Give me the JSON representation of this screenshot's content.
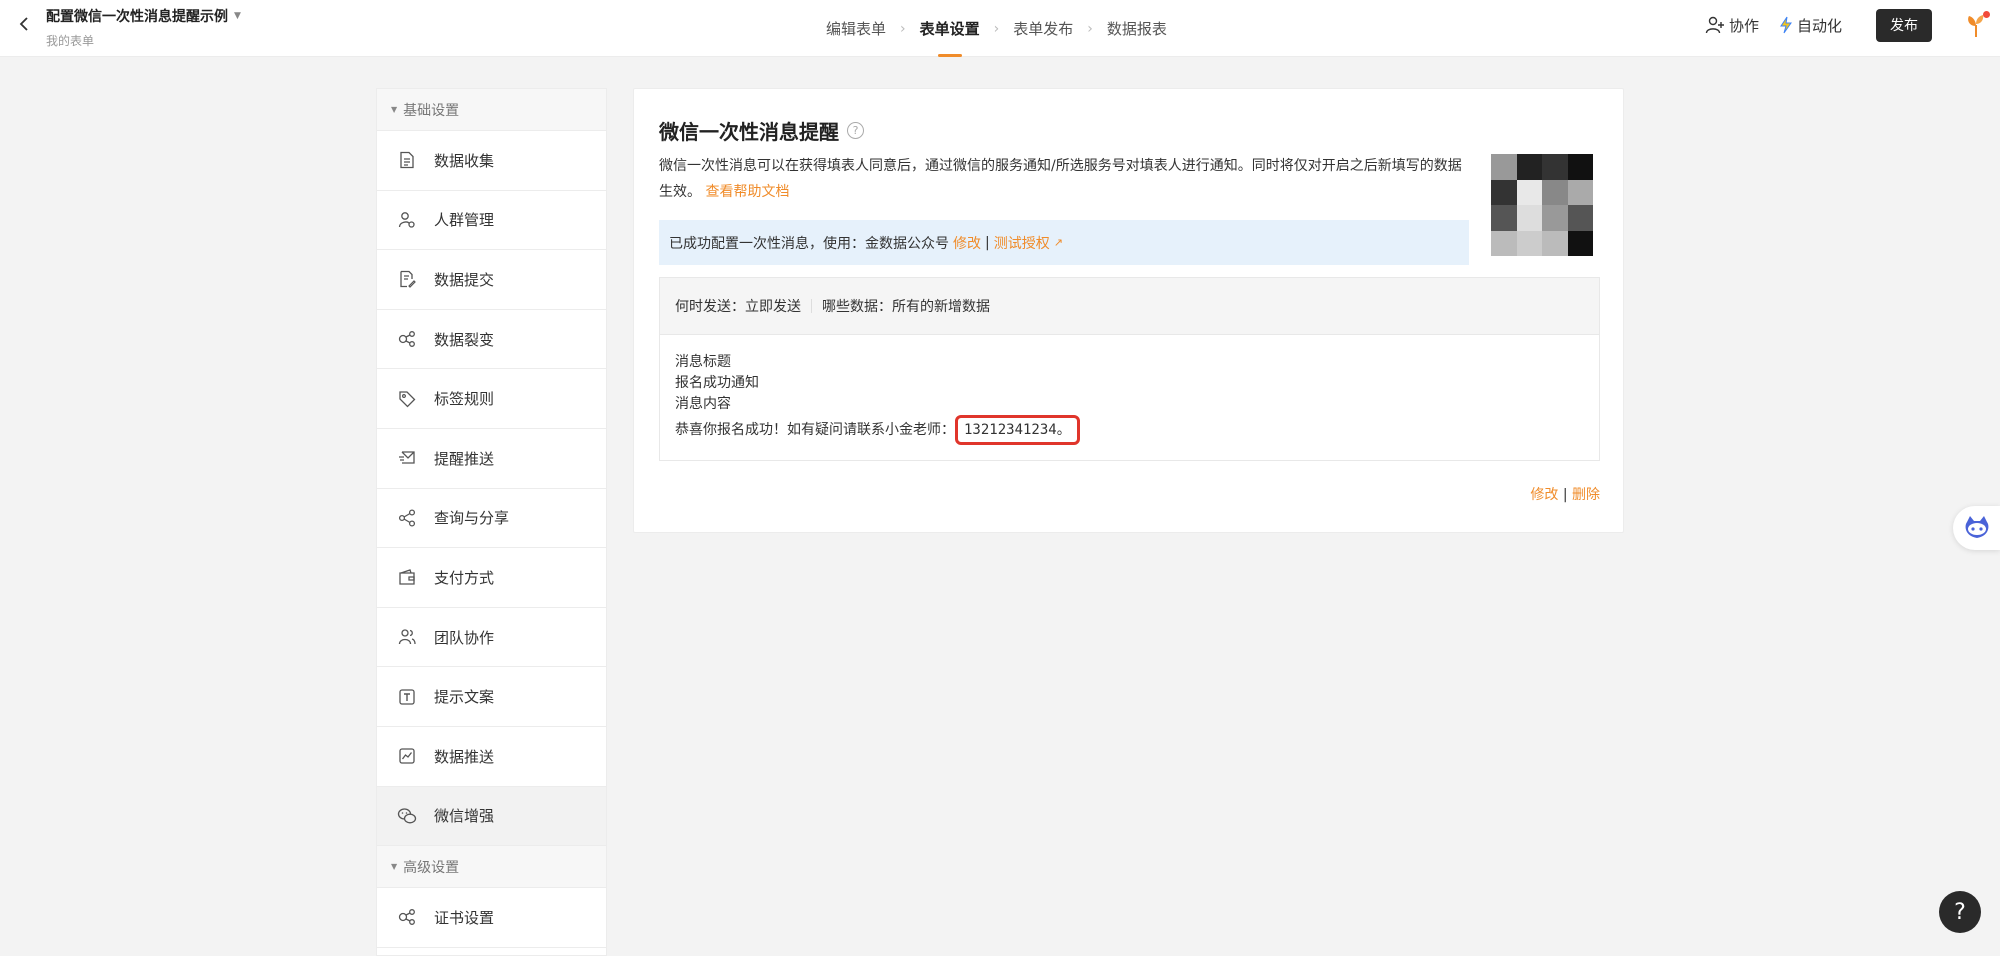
{
  "header": {
    "title": "配置微信一次性消息提醒示例",
    "subtitle": "我的表单",
    "steps": [
      "编辑表单",
      "表单设置",
      "表单发布",
      "数据报表"
    ],
    "active_step": 1,
    "collab_label": "协作",
    "automation_label": "自动化",
    "publish_label": "发布"
  },
  "sidebar": {
    "group_basic": "基础设置",
    "group_advanced": "高级设置",
    "items": [
      {
        "label": "数据收集",
        "icon": "document-icon"
      },
      {
        "label": "人群管理",
        "icon": "user-settings-icon"
      },
      {
        "label": "数据提交",
        "icon": "document-edit-icon"
      },
      {
        "label": "数据裂变",
        "icon": "share-nodes-icon"
      },
      {
        "label": "标签规则",
        "icon": "tag-icon"
      },
      {
        "label": "提醒推送",
        "icon": "mail-send-icon"
      },
      {
        "label": "查询与分享",
        "icon": "share-icon"
      },
      {
        "label": "支付方式",
        "icon": "wallet-icon"
      },
      {
        "label": "团队协作",
        "icon": "team-icon"
      },
      {
        "label": "提示文案",
        "icon": "text-box-icon"
      },
      {
        "label": "数据推送",
        "icon": "chart-line-icon"
      },
      {
        "label": "微信增强",
        "icon": "wechat-icon"
      }
    ],
    "advanced_items": [
      {
        "label": "证书设置",
        "icon": "certificate-icon"
      }
    ]
  },
  "card": {
    "title": "微信一次性消息提醒",
    "desc": "微信一次性消息可以在获得填表人同意后，通过微信的服务通知/所选服务号对填表人进行通知。同时将仅对开启之后新填写的数据生效。",
    "help_link": "查看帮助文档",
    "notice_text": "已成功配置一次性消息，使用：金数据公众号",
    "notice_edit": "修改",
    "notice_sep": "|",
    "notice_test": "测试授权",
    "when_label": "何时发送：立即发送",
    "which_label": "哪些数据：所有的新增数据",
    "msg_title_label": "消息标题",
    "msg_title": "报名成功通知",
    "msg_content_label": "消息内容",
    "msg_content_prefix": "恭喜你报名成功！如有疑问请联系小金老师：",
    "msg_content_highlight": "13212341234。",
    "action_edit": "修改",
    "action_sep": "|",
    "action_delete": "删除"
  },
  "qr": {
    "cells": [
      "#999999",
      "#222222",
      "#333333",
      "#111111",
      "#333333",
      "#e8e8e8",
      "#888888",
      "#aaaaaa",
      "#555555",
      "#dddddd",
      "#999999",
      "#555555",
      "#bbbbbb",
      "#cccccc",
      "#bbbbbb",
      "#111111"
    ]
  },
  "fab": {
    "help_label": "?"
  },
  "colors": {
    "accent": "#f08c2a",
    "highlight_border": "#e0352b",
    "notice_bg": "#e6f1fb"
  }
}
